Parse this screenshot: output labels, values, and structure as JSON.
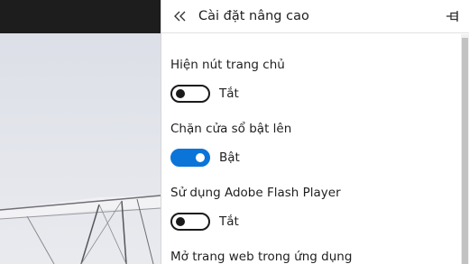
{
  "panel": {
    "title": "Cài đặt nâng cao",
    "back_icon": "double-chevron-left-icon",
    "pin_icon": "pin-icon"
  },
  "settings": [
    {
      "label": "Hiện nút trang chủ",
      "state": "Tắt",
      "on": false
    },
    {
      "label": "Chặn cửa sổ bật lên",
      "state": "Bật",
      "on": true
    },
    {
      "label": "Sử dụng Adobe Flash Player",
      "state": "Tắt",
      "on": false
    },
    {
      "label": "Mở trang web trong ứng dụng"
    }
  ],
  "colors": {
    "toggle_on": "#0a74d8",
    "toggle_off_border": "#1a1a1a",
    "top_bar": "#1d1d1d"
  }
}
